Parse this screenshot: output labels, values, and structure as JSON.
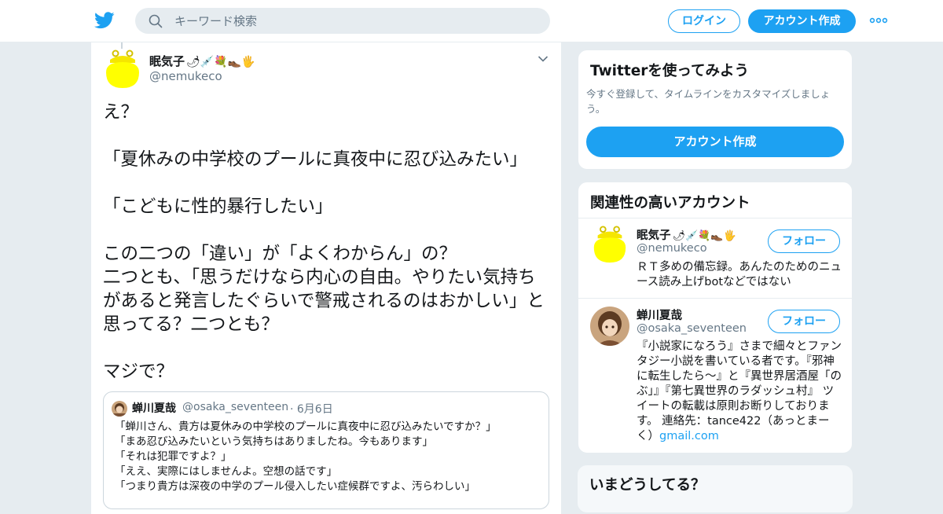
{
  "header": {
    "search_placeholder": "キーワード検索",
    "login_label": "ログイン",
    "signup_label": "アカウント作成",
    "brand_color": "#1da1f2"
  },
  "tweet": {
    "author_name": "眠気子",
    "author_emoji": "🌶💉💐👞🖐",
    "author_handle": "@nemukeco",
    "text": "え？\n\n「夏休みの中学校のプールに真夜中に忍び込みたい」\n\n「こどもに性的暴行したい」\n\nこの二つの「違い」が「よくわからん」の？\n二つとも、「思うだけなら内心の自由。やりたい気持ちがあると発言したぐらいで警戒されるのはおかしい」と思ってる？二つとも？\n\nマジで？",
    "quote": {
      "name": "蝉川夏哉",
      "handle": "@osaka_seventeen",
      "date": "· 6月6日",
      "text": "「蝉川さん、貴方は夏休みの中学校のプールに真夜中に忍び込みたいですか？」\n「まあ忍び込みたいという気持ちはありましたね。今もあります」\n「それは犯罪ですよ？」\n「ええ、実際にはしませんよ。空想の話です」\n「つまり貴方は深夜の中学のプール侵入したい症候群ですよ、汚らわしい」"
    }
  },
  "sidebar": {
    "signup_card": {
      "title": "Twitterを使ってみよう",
      "description": "今すぐ登録して、タイムラインをカスタマイズしましょう。",
      "button_label": "アカウント作成"
    },
    "related": {
      "title": "関連性の高いアカウント",
      "follow_label": "フォロー",
      "accounts": [
        {
          "name": "眠気子",
          "emoji": "🌶💉💐👞🖐",
          "handle": "@nemukeco",
          "bio": "ＲＴ多めの備忘録。あんたのためのニュース読み上げbotなどではない"
        },
        {
          "name": "蝉川夏哉",
          "handle": "@osaka_seventeen",
          "bio": "『小説家になろう』さまで細々とファンタジー小説を書いている者です。『邪神に転生したら～』と『異世界居酒屋「のぶ」』『第七異世界のラダッシュ村』 ツイートの転載は原則お断りしております。 連絡先：tance422（あっとまーく）",
          "bio_link": "gmail.com"
        }
      ]
    },
    "trends_title": "いまどうしてる？"
  }
}
